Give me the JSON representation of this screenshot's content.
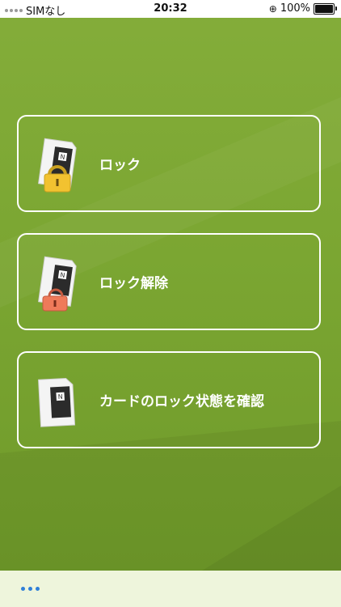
{
  "status_bar": {
    "carrier": "SIMなし",
    "time": "20:32",
    "battery": "100%"
  },
  "menu": {
    "items": [
      {
        "label": "ロック",
        "icon": "sd-card-locked-icon"
      },
      {
        "label": "ロック解除",
        "icon": "sd-card-unlock-icon"
      },
      {
        "label": "カードのロック状態を確認",
        "icon": "sd-card-icon"
      }
    ]
  },
  "bottom_bar": {
    "icon": "more-icon"
  },
  "colors": {
    "background": "#7ba632",
    "card_border": "#ffffff",
    "lock_yellow": "#f2c230",
    "lock_red": "#ef7a5a",
    "more_dots": "#2f7fd8"
  }
}
